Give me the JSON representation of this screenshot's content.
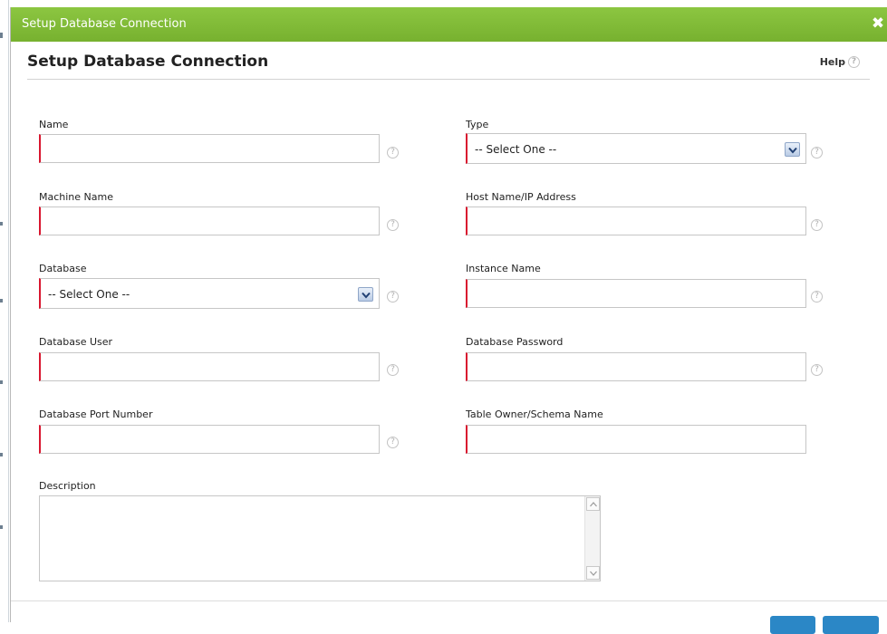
{
  "dialog": {
    "titlebar_title": "Setup Database Connection",
    "close_icon": "close-icon",
    "heading": "Setup Database Connection",
    "help_label": "Help",
    "help_icon": "?"
  },
  "form": {
    "name_label": "Name",
    "type_label": "Type",
    "type_value": "-- Select One --",
    "machine_name_label": "Machine Name",
    "host_label": "Host Name/IP Address",
    "database_label": "Database",
    "database_value": "-- Select One --",
    "instance_label": "Instance Name",
    "db_user_label": "Database User",
    "db_password_label": "Database Password",
    "port_label": "Database Port Number",
    "schema_label": "Table Owner/Schema Name",
    "description_label": "Description",
    "help_glyph": "?"
  },
  "colors": {
    "titlebar": "#7ab632",
    "required_marker": "#d9172f",
    "button": "#2b87c6"
  }
}
